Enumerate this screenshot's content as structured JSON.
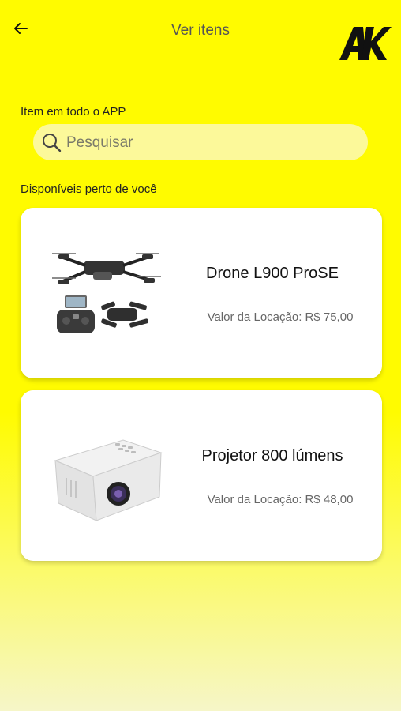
{
  "header": {
    "title": "Ver itens",
    "back_icon": "arrow-left-icon",
    "logo_text": "AK"
  },
  "search": {
    "section_label": "Item em todo o APP",
    "placeholder": "Pesquisar",
    "value": ""
  },
  "nearby": {
    "section_label": "Disponíveis perto de você",
    "items": [
      {
        "name": "Drone L900 ProSE",
        "price_label": "Valor da Locação: R$ 75,00",
        "image": "drone-image"
      },
      {
        "name": "Projetor 800 lúmens",
        "price_label": "Valor da Locação: R$ 48,00",
        "image": "projector-image"
      }
    ]
  },
  "colors": {
    "background": "#FFFB00",
    "search_bg": "#FCF99A",
    "card_bg": "#FFFFFF"
  }
}
